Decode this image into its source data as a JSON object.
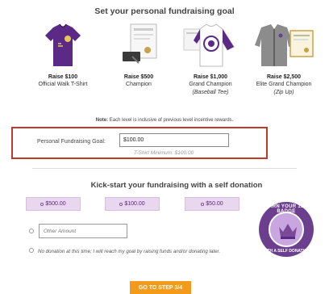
{
  "goal_section": {
    "title": "Set your personal fundraising goal",
    "rewards": [
      {
        "level": "Raise $100",
        "name": "Official Walk T-Shirt",
        "sub": "",
        "icon": "tshirt-icon"
      },
      {
        "level": "Raise $500",
        "name": "Champion",
        "sub": "",
        "icon": "certificate-icon"
      },
      {
        "level": "Raise $1,000",
        "name": "Grand Champion",
        "sub": "(Baseball Tee)",
        "icon": "baseball-tee-icon"
      },
      {
        "level": "Raise $2,500",
        "name": "Elite Grand Champion",
        "sub": "(Zip Up)",
        "icon": "zip-up-hoodie-icon"
      }
    ],
    "note_label": "Note:",
    "note_text": "Each level is inclusive of previous level incentive rewards.",
    "goal_label": "Personal Fundraising Goal:",
    "goal_value": "$100.00",
    "goal_minimum": "T-Shirt Minimum: $100.00"
  },
  "donation_section": {
    "title": "Kick-start your fundraising with a self donation",
    "amounts": [
      "$500.00",
      "$100.00",
      "$50.00"
    ],
    "other_placeholder": "Other Amount",
    "no_donation_text": "No donation at this time; I will reach my goal by raising funds and/or donating later.",
    "badge_top": "EARN YOUR 1ST BADGE",
    "badge_bottom": "WITH A SELF DONATION"
  },
  "next_button_label": "GO TO STEP 3/4",
  "colors": {
    "accent_purple": "#6b3f8e",
    "light_purple": "#e9d6ef",
    "highlight_border": "#c0392b",
    "cta_orange": "#f39a1b"
  }
}
